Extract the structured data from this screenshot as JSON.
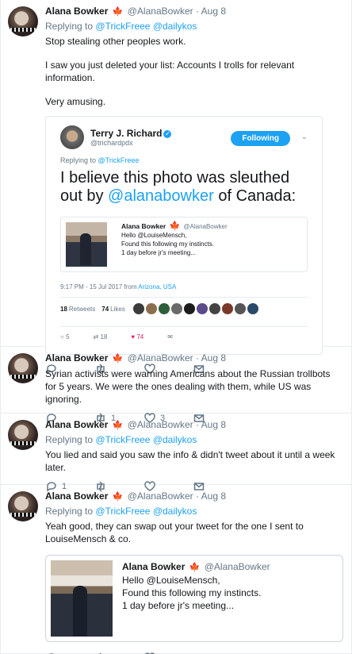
{
  "tweets": [
    {
      "name": "Alana Bowker",
      "flag": "🍁",
      "handle": "@AlanaBowker",
      "time": "· Aug 8",
      "reply_prefix": "Replying to",
      "reply_to": [
        "@TrickFreee",
        "@dailykos"
      ],
      "paragraphs": [
        "Stop stealing other peoples work.",
        "I saw you just deleted your list: Accounts I trolls for relevant information.",
        "Very amusing."
      ],
      "counts": {
        "reply": "",
        "retweet": "",
        "like": ""
      },
      "screenshot": {
        "name": "Terry J. Richard",
        "verified": "✓",
        "handle": "@trichardpdx",
        "follow_label": "Following",
        "chevron": "⌄",
        "reply_prefix": "Replying to",
        "reply_to": "@TrickFreee",
        "text_a": "I believe this photo was sleuthed out by",
        "text_mention": "@alanabowker",
        "text_b": "of Canada:",
        "quote": {
          "name": "Alana Bowker",
          "flag": "🍁",
          "handle": "@AlanaBowker",
          "lines": [
            "Hello @LouiseMensch,",
            "Found this following my instincts.",
            "1 day before jr's meeting..."
          ]
        },
        "time": "9:17 PM - 15 Jul 2017 from",
        "place": "Arizona, USA",
        "retweets_count": "18",
        "retweets_label": "Retweets",
        "likes_count": "74",
        "likes_label": "Likes",
        "action_counts": [
          "5",
          "18",
          "74"
        ],
        "face_colors": [
          "#3b3b3b",
          "#8a6f4e",
          "#2f5d3a",
          "#6a6a6a",
          "#1c1c1c",
          "#5b4a8a",
          "#444",
          "#7a3a2a",
          "#555",
          "#2a4a6a"
        ]
      }
    },
    {
      "name": "Alana Bowker",
      "flag": "🍁",
      "handle": "@AlanaBowker",
      "time": "· Aug 8",
      "paragraphs": [
        "Syrian activists were warning Americans about the Russian trollbots for 5 years. We were the ones dealing with them, while US was ignoring."
      ],
      "counts": {
        "reply": "",
        "retweet": "1",
        "like": "3"
      }
    },
    {
      "name": "Alana Bowker",
      "flag": "🍁",
      "handle": "@AlanaBowker",
      "time": "· Aug 8",
      "reply_prefix": "Replying to",
      "reply_to": [
        "@TrickFreee",
        "@dailykos"
      ],
      "paragraphs": [
        "You lied and said you saw the info & didn't tweet about it until a week later."
      ],
      "counts": {
        "reply": "1",
        "retweet": "",
        "like": ""
      }
    },
    {
      "name": "Alana Bowker",
      "flag": "🍁",
      "handle": "@AlanaBowker",
      "time": "· Aug 8",
      "reply_prefix": "Replying to",
      "reply_to": [
        "@TrickFreee",
        "@dailykos"
      ],
      "paragraphs": [
        "Yeah good, they can swap out your tweet for the one I sent to LouiseMensch & co."
      ],
      "counts": {
        "reply": "",
        "retweet": "",
        "like": ""
      },
      "quoted": {
        "name": "Alana Bowker",
        "flag": "🍁",
        "handle": "@AlanaBowker",
        "lines": [
          "Hello @LouiseMensch,",
          "Found this following my instincts.",
          "1 day before jr's meeting..."
        ]
      }
    }
  ],
  "icons": {
    "reply": "reply-icon",
    "retweet": "retweet-icon",
    "like": "heart-icon",
    "dm": "envelope-icon"
  },
  "colors": {
    "accent": "#1da1f2",
    "like": "#e0245e",
    "muted": "#657786"
  }
}
